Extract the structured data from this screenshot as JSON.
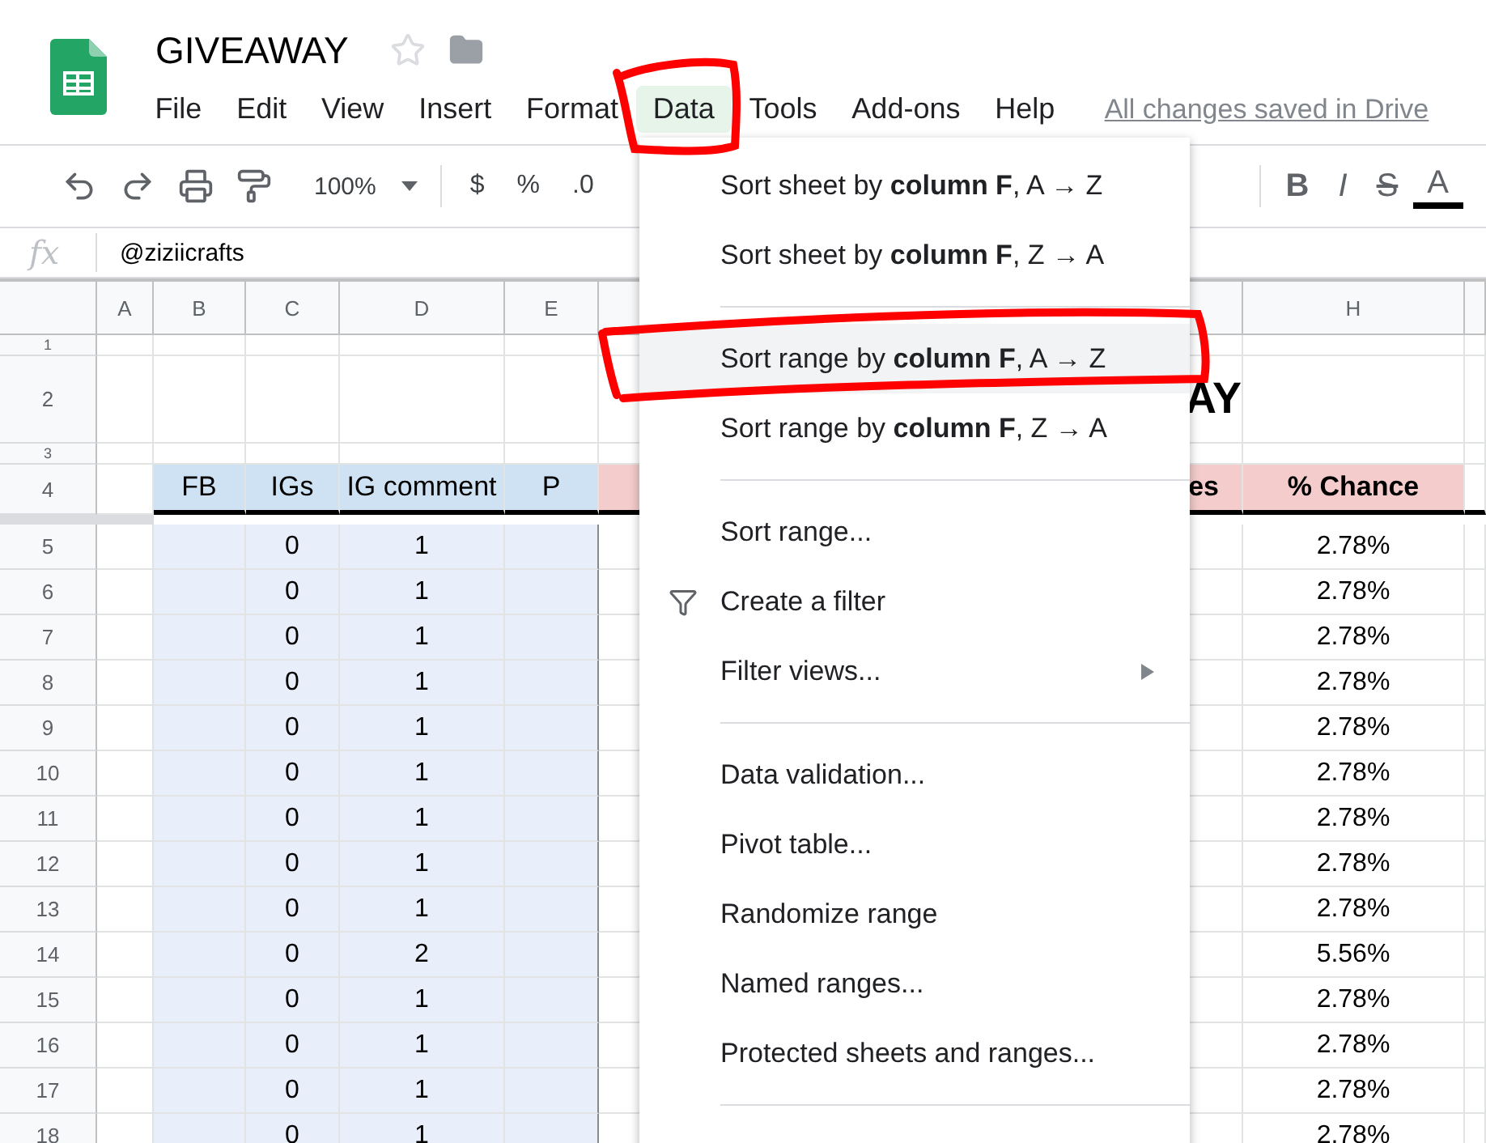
{
  "document": {
    "title": "GIVEAWAY",
    "save_status": "All changes saved in Drive"
  },
  "menu_bar": [
    {
      "label": "File",
      "selected": false
    },
    {
      "label": "Edit",
      "selected": false
    },
    {
      "label": "View",
      "selected": false
    },
    {
      "label": "Insert",
      "selected": false
    },
    {
      "label": "Format",
      "selected": false
    },
    {
      "label": "Data",
      "selected": true
    },
    {
      "label": "Tools",
      "selected": false
    },
    {
      "label": "Add-ons",
      "selected": false
    },
    {
      "label": "Help",
      "selected": false
    }
  ],
  "toolbar": {
    "zoom": "100%",
    "format_buttons": [
      "$",
      "%",
      ".0"
    ],
    "style_buttons": [
      "B",
      "I",
      "S",
      "A"
    ]
  },
  "formula_bar": {
    "label": "fx",
    "value": "@ziziicrafts"
  },
  "column_headers": [
    "A",
    "B",
    "C",
    "D",
    "E",
    "H"
  ],
  "rows": [
    {
      "number": "1",
      "kind": "spacer"
    },
    {
      "number": "2",
      "kind": "title",
      "column_7": "AY"
    },
    {
      "number": "3",
      "kind": "spacer"
    },
    {
      "number": "4",
      "kind": "header",
      "fb": "FB",
      "igs": "IGs",
      "ig_comment": "IG comment",
      "p": "P",
      "column_7": "es",
      "chance": "% Chance"
    },
    {
      "number": "5",
      "kind": "data",
      "igs": "0",
      "ig_comment": "1",
      "chance": "2.78%"
    },
    {
      "number": "6",
      "kind": "data",
      "igs": "0",
      "ig_comment": "1",
      "chance": "2.78%"
    },
    {
      "number": "7",
      "kind": "data",
      "igs": "0",
      "ig_comment": "1",
      "chance": "2.78%"
    },
    {
      "number": "8",
      "kind": "data",
      "igs": "0",
      "ig_comment": "1",
      "chance": "2.78%"
    },
    {
      "number": "9",
      "kind": "data",
      "igs": "0",
      "ig_comment": "1",
      "chance": "2.78%"
    },
    {
      "number": "10",
      "kind": "data",
      "igs": "0",
      "ig_comment": "1",
      "chance": "2.78%"
    },
    {
      "number": "11",
      "kind": "data",
      "igs": "0",
      "ig_comment": "1",
      "chance": "2.78%"
    },
    {
      "number": "12",
      "kind": "data",
      "igs": "0",
      "ig_comment": "1",
      "chance": "2.78%"
    },
    {
      "number": "13",
      "kind": "data",
      "igs": "0",
      "ig_comment": "1",
      "chance": "2.78%"
    },
    {
      "number": "14",
      "kind": "data",
      "igs": "0",
      "ig_comment": "2",
      "chance": "5.56%"
    },
    {
      "number": "15",
      "kind": "data",
      "igs": "0",
      "ig_comment": "1",
      "chance": "2.78%"
    },
    {
      "number": "16",
      "kind": "data",
      "igs": "0",
      "ig_comment": "1",
      "chance": "2.78%"
    },
    {
      "number": "17",
      "kind": "data",
      "igs": "0",
      "ig_comment": "1",
      "chance": "2.78%"
    },
    {
      "number": "18",
      "kind": "data",
      "igs": "0",
      "ig_comment": "1",
      "chance": "2.78%"
    }
  ],
  "data_menu": [
    {
      "kind": "item",
      "label": "Sort sheet by **column F**, A → Z",
      "selected": false
    },
    {
      "kind": "item",
      "label": "Sort sheet by **column F**, Z → A",
      "selected": false
    },
    {
      "kind": "separator"
    },
    {
      "kind": "item",
      "label": "Sort range by **column F**, A → Z",
      "selected": true
    },
    {
      "kind": "item",
      "label": "Sort range by **column F**, Z → A",
      "selected": false
    },
    {
      "kind": "separator"
    },
    {
      "kind": "item",
      "label": "Sort range...",
      "selected": false
    },
    {
      "kind": "icon_item",
      "label": "Create a filter",
      "selected": false
    },
    {
      "kind": "submenu_item",
      "label": "Filter views...",
      "selected": false
    },
    {
      "kind": "separator"
    },
    {
      "kind": "item",
      "label": "Data validation...",
      "selected": false
    },
    {
      "kind": "item",
      "label": "Pivot table...",
      "selected": false
    },
    {
      "kind": "item",
      "label": "Randomize range",
      "selected": false
    },
    {
      "kind": "item",
      "label": "Named ranges...",
      "selected": false
    },
    {
      "kind": "item",
      "label": "Protected sheets and ranges...",
      "selected": false
    },
    {
      "kind": "separator"
    }
  ]
}
